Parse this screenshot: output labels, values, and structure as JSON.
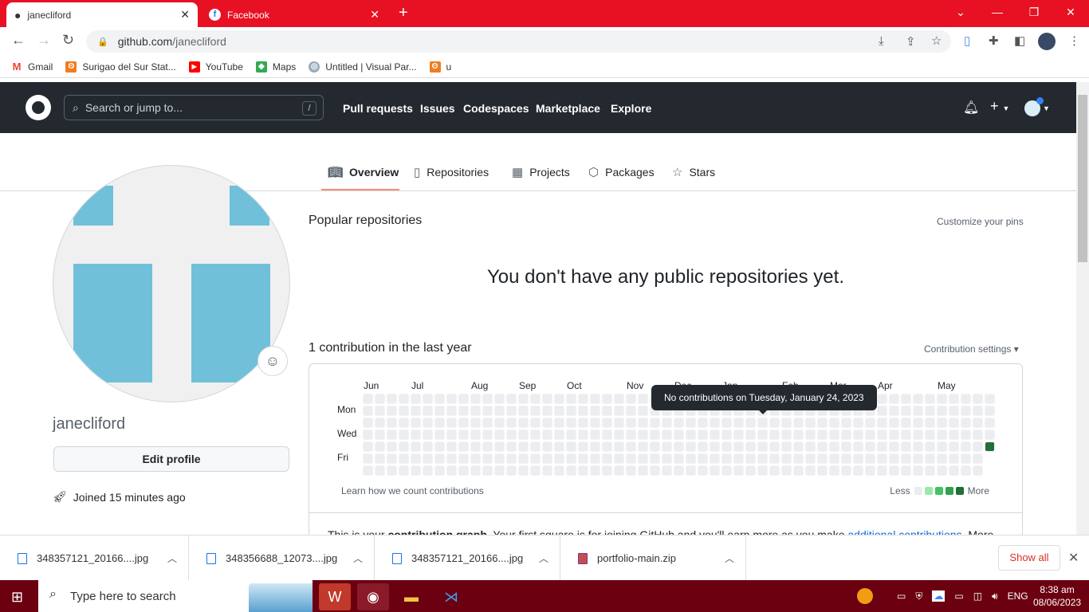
{
  "browser": {
    "tabs": [
      {
        "title": "janecliford",
        "icon": "github-icon",
        "active": true
      },
      {
        "title": "Facebook",
        "icon": "facebook-icon",
        "active": false
      }
    ],
    "url_domain": "github.com",
    "url_path": "/janecliford",
    "bookmarks": [
      {
        "label": "Gmail",
        "icon": "gmail-icon"
      },
      {
        "label": "Surigao del Sur Stat...",
        "icon": "xampp-icon"
      },
      {
        "label": "YouTube",
        "icon": "youtube-icon"
      },
      {
        "label": "Maps",
        "icon": "maps-icon"
      },
      {
        "label": "Untitled | Visual Par...",
        "icon": "visual-paradigm-icon"
      },
      {
        "label": "u",
        "icon": "xampp-icon"
      }
    ]
  },
  "github": {
    "search_placeholder": "Search or jump to...",
    "search_shortcut": "/",
    "nav": [
      "Pull requests",
      "Issues",
      "Codespaces",
      "Marketplace",
      "Explore"
    ],
    "profile_tabs": [
      "Overview",
      "Repositories",
      "Projects",
      "Packages",
      "Stars"
    ],
    "username": "janecliford",
    "edit_profile": "Edit profile",
    "joined": "Joined 15 minutes ago",
    "popular_title": "Popular repositories",
    "customize_pins": "Customize your pins",
    "no_repos": "You don't have any public repositories yet.",
    "contrib_title": "1 contribution in the last year",
    "contrib_settings": "Contribution settings ▾",
    "learn": "Learn how we count contributions",
    "less": "Less",
    "more": "More",
    "tooltip": "No contributions on Tuesday, January 24, 2023",
    "graph_text_1": "This is your ",
    "graph_text_bold": "contribution graph",
    "graph_text_2": ". Your first square is for joining GitHub and you'll earn more as you make ",
    "graph_text_link": "additional contributions",
    "graph_text_3": ". More"
  },
  "chart_data": {
    "type": "heatmap",
    "weeks": 53,
    "days_per_week": 7,
    "last_week_days": 5,
    "months": [
      {
        "label": "Jun",
        "week": 0
      },
      {
        "label": "Jul",
        "week": 4
      },
      {
        "label": "Aug",
        "week": 9
      },
      {
        "label": "Sep",
        "week": 13
      },
      {
        "label": "Oct",
        "week": 17
      },
      {
        "label": "Nov",
        "week": 22
      },
      {
        "label": "Dec",
        "week": 26
      },
      {
        "label": "Jan",
        "week": 30
      },
      {
        "label": "Feb",
        "week": 35
      },
      {
        "label": "Mar",
        "week": 39
      },
      {
        "label": "Apr",
        "week": 43
      },
      {
        "label": "May",
        "week": 48
      }
    ],
    "day_labels": [
      {
        "label": "Mon",
        "day": 1
      },
      {
        "label": "Wed",
        "day": 3
      },
      {
        "label": "Fri",
        "day": 5
      }
    ],
    "contributions": [
      {
        "week": 52,
        "day": 4,
        "level": 4
      }
    ],
    "level_colors": [
      "#ebedf0",
      "#9be9a8",
      "#40c463",
      "#30a14e",
      "#216e39"
    ]
  },
  "downloads": {
    "files": [
      "348357121_20166....jpg",
      "348356688_12073....jpg",
      "348357121_20166....jpg",
      "portfolio-main.zip"
    ],
    "show_all": "Show all"
  },
  "taskbar": {
    "search_placeholder": "Type here to search",
    "lang": "ENG",
    "time": "8:38 am",
    "date": "08/06/2023"
  }
}
